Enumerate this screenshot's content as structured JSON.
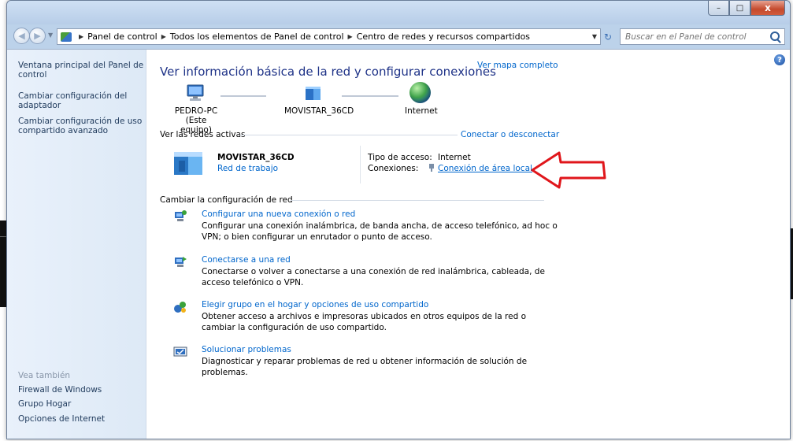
{
  "window": {
    "controls": {
      "minimize": "–",
      "maximize": "□",
      "close": "x"
    }
  },
  "address_bar": {
    "crumbs": [
      "Panel de control",
      "Todos los elementos de Panel de control",
      "Centro de redes y recursos compartidos"
    ]
  },
  "search": {
    "placeholder": "Buscar en el Panel de control"
  },
  "sidebar": {
    "links": [
      "Ventana principal del Panel de control",
      "Cambiar configuración del adaptador",
      "Cambiar configuración de uso compartido avanzado"
    ],
    "see_also_title": "Vea también",
    "see_also": [
      "Firewall de Windows",
      "Grupo Hogar",
      "Opciones de Internet"
    ]
  },
  "main": {
    "title": "Ver información básica de la red y configurar conexiones",
    "map_link": "Ver mapa completo",
    "nodes": {
      "pc": "PEDRO-PC",
      "pc_sub": "(Este equipo)",
      "network": "MOVISTAR_36CD",
      "internet": "Internet"
    },
    "active_networks": {
      "header": "Ver las redes activas",
      "connect_link": "Conectar o desconectar",
      "name": "MOVISTAR_36CD",
      "type_link": "Red de trabajo",
      "access_label": "Tipo de acceso:",
      "access_value": "Internet",
      "connections_label": "Conexiones:",
      "connection_link": "Conexión de área local"
    },
    "change_settings": {
      "header": "Cambiar la configuración de red",
      "tasks": [
        {
          "title": "Configurar una nueva conexión o red",
          "desc": "Configurar una conexión inalámbrica, de banda ancha, de acceso telefónico, ad hoc o VPN; o bien configurar un enrutador o punto de acceso."
        },
        {
          "title": "Conectarse a una red",
          "desc": "Conectarse o volver a conectarse a una conexión de red inalámbrica, cableada, de acceso telefónico o VPN."
        },
        {
          "title": "Elegir grupo en el hogar y opciones de uso compartido",
          "desc": "Obtener acceso a archivos e impresoras ubicados en otros equipos de la red o cambiar la configuración de uso compartido."
        },
        {
          "title": "Solucionar problemas",
          "desc": "Diagnosticar y reparar problemas de red u obtener información de solución de problemas."
        }
      ]
    }
  },
  "annotation": {
    "arrow_color": "#e0161b"
  }
}
